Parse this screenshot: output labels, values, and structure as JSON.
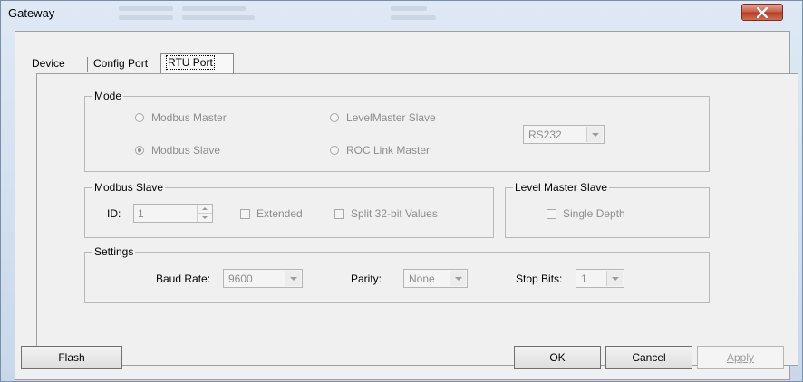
{
  "window": {
    "title": "Gateway"
  },
  "tabs": [
    {
      "label": "Device"
    },
    {
      "label": "Config Port"
    },
    {
      "label": "RTU Port"
    }
  ],
  "mode": {
    "legend": "Mode",
    "modbus_master": "Modbus Master",
    "modbus_slave": "Modbus Slave",
    "levelmaster_slave": "LevelMaster Slave",
    "roc_link_master": "ROC Link Master",
    "selected": "Modbus Slave",
    "interface": "RS232"
  },
  "modbus_slave": {
    "legend": "Modbus Slave",
    "id_label": "ID:",
    "id_value": "1",
    "extended": "Extended",
    "split": "Split 32-bit Values"
  },
  "level_master_slave": {
    "legend": "Level Master Slave",
    "single_depth": "Single Depth"
  },
  "settings": {
    "legend": "Settings",
    "baud_label": "Baud Rate:",
    "baud_value": "9600",
    "parity_label": "Parity:",
    "parity_value": "None",
    "stop_label": "Stop Bits:",
    "stop_value": "1"
  },
  "buttons": {
    "flash": "Flash",
    "ok": "OK",
    "cancel": "Cancel",
    "apply": "Apply"
  }
}
